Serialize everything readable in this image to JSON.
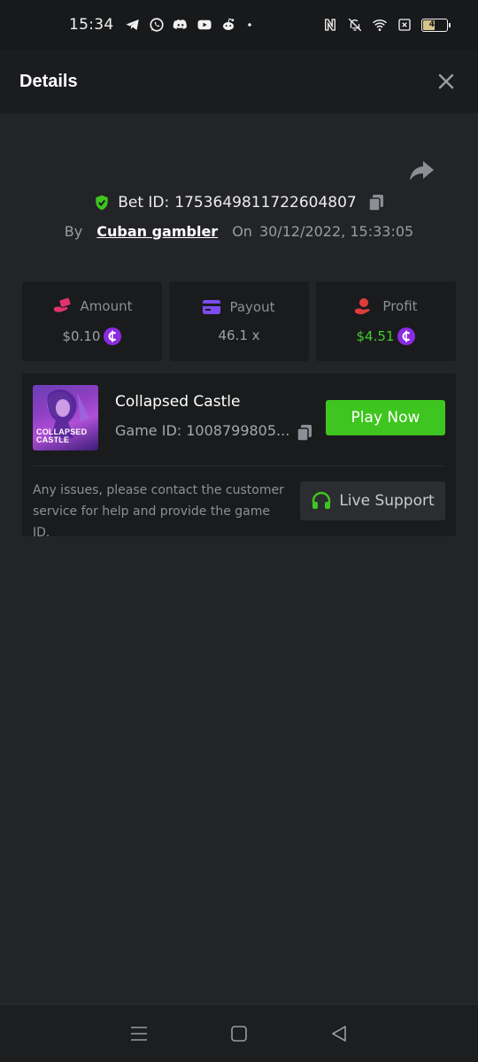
{
  "status_bar": {
    "time": "15:34",
    "battery_level": "46",
    "icons_left": [
      "telegram-icon",
      "whatsapp-icon",
      "discord-icon",
      "youtube-icon",
      "reddit-icon",
      "dot-icon"
    ],
    "icons_right": [
      "nfc-icon",
      "mute-icon",
      "wifi-icon",
      "sim-off-icon",
      "battery-icon"
    ]
  },
  "header": {
    "title": "Details"
  },
  "bet": {
    "label": "Bet ID:",
    "id": "1753649811722604807",
    "by_label": "By",
    "user": "Cuban gambler",
    "on_label": "On",
    "date": "30/12/2022, 15:33:05"
  },
  "stats": {
    "amount": {
      "label": "Amount",
      "value": "$0.10"
    },
    "payout": {
      "label": "Payout",
      "value": "46.1 x"
    },
    "profit": {
      "label": "Profit",
      "value": "$4.51"
    }
  },
  "game": {
    "name": "Collapsed Castle",
    "id_text": "Game ID: 1008799805...",
    "thumb_line1": "COLLAPSED",
    "thumb_line2": "CASTLE",
    "play_label": "Play Now"
  },
  "support": {
    "text": "Any issues, please contact the customer service for help and provide the game ID.",
    "button_label": "Live Support"
  },
  "colors": {
    "accent_green": "#3fc51f",
    "profit_green": "#3ecf2a",
    "coin_purple": "#8a2be2",
    "amount_pink": "#e0336e",
    "payout_purple": "#7b4cf0",
    "profit_red": "#e23b3b"
  }
}
